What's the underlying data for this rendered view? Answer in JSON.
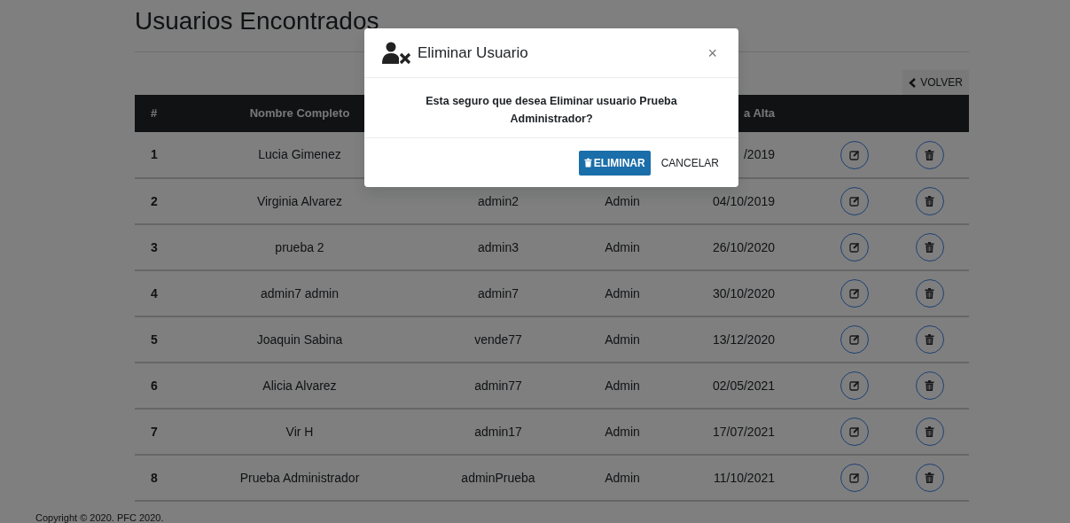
{
  "page": {
    "title": "Usuarios Encontrados",
    "back_button": "VOLVER"
  },
  "table": {
    "header": {
      "column_1": "#",
      "column_2": "Nombre Completo",
      "column_5": "a Alta"
    },
    "rows": [
      {
        "number": "1",
        "name": "Lucia Gimenez",
        "date": "/2019"
      },
      {
        "number": "2",
        "name": "Virginia Alvarez",
        "username": "admin2",
        "role": "Admin",
        "date": "04/10/2019"
      },
      {
        "number": "3",
        "name": "prueba 2",
        "username": "admin3",
        "role": "Admin",
        "date": "26/10/2020"
      },
      {
        "number": "4",
        "name": "admin7 admin",
        "username": "admin7",
        "role": "Admin",
        "date": "30/10/2020"
      },
      {
        "number": "5",
        "name": "Joaquin Sabina",
        "username": "vende77",
        "role": "Admin",
        "date": "13/12/2020"
      },
      {
        "number": "6",
        "name": "Alicia Alvarez",
        "username": "admin77",
        "role": "Admin",
        "date": "02/05/2021"
      },
      {
        "number": "7",
        "name": "Vir H",
        "username": "admin17",
        "role": "Admin",
        "date": "17/07/2021"
      },
      {
        "number": "8",
        "name": "Prueba Administrador",
        "username": "adminPrueba",
        "role": "Admin",
        "date": "11/10/2021"
      }
    ]
  },
  "footer": "Copyright © 2020. PFC 2020.",
  "modal": {
    "title": "Eliminar Usuario",
    "close": "×",
    "message": "Esta seguro que desea Eliminar usuario Prueba Administrador?",
    "confirm_button": "ELIMINAR",
    "cancel_button": "CANCELAR"
  }
}
